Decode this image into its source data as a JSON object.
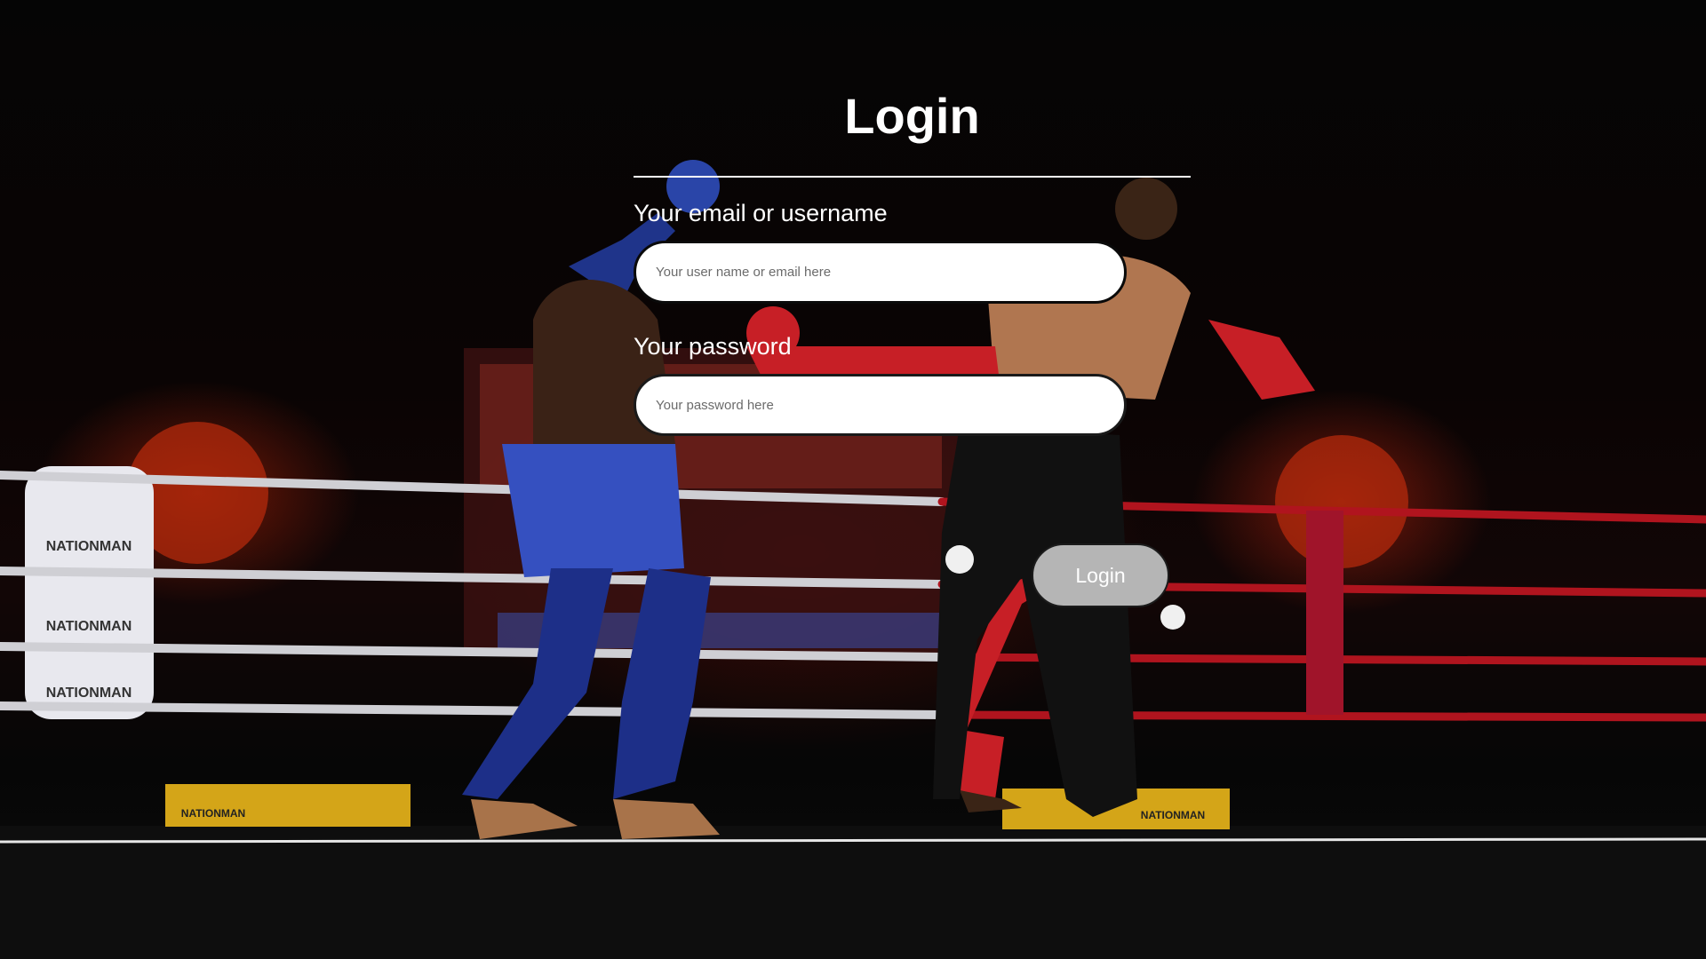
{
  "page": {
    "title": "Login"
  },
  "form": {
    "email": {
      "label": "Your email or username",
      "placeholder": "Your user name or email here",
      "value": ""
    },
    "password": {
      "label": "Your password",
      "placeholder": "Your password here",
      "value": ""
    },
    "submit_label": "Login"
  },
  "background": {
    "subject": "muay-thai-match-photo",
    "sponsor_text": "NATIONMAN"
  },
  "colors": {
    "title_text": "#ffffff",
    "divider": "#ffffff",
    "input_bg": "#ffffff",
    "input_border": "#0a0a0a",
    "button_bg": "#b5b5b5",
    "button_text": "#ffffff",
    "ring_red": "#c8141e",
    "shorts_blue": "#2b3fa8"
  }
}
